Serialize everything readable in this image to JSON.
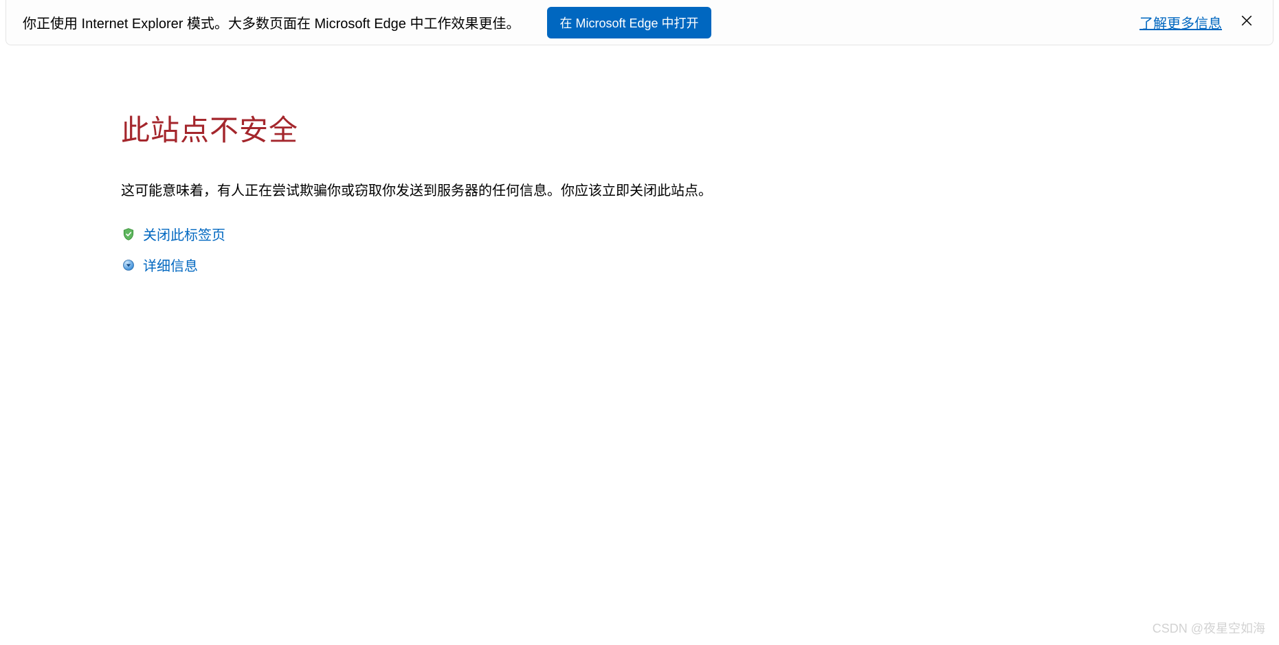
{
  "infobar": {
    "message": "你正使用 Internet Explorer 模式。大多数页面在 Microsoft Edge 中工作效果更佳。",
    "open_button": "在 Microsoft Edge 中打开",
    "learn_more": "了解更多信息"
  },
  "error": {
    "headline": "此站点不安全",
    "description": "这可能意味着，有人正在尝试欺骗你或窃取你发送到服务器的任何信息。你应该立即关闭此站点。",
    "close_tab": "关闭此标签页",
    "details": "详细信息"
  },
  "watermark": "CSDN @夜星空如海"
}
